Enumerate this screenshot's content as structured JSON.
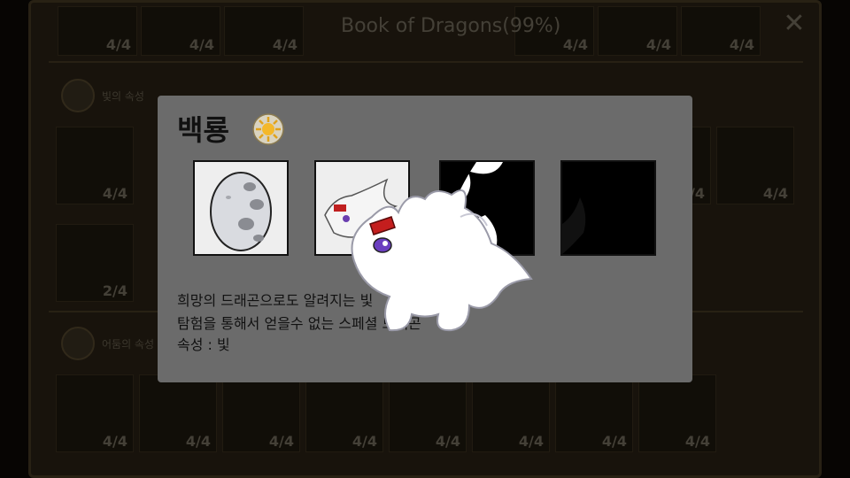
{
  "book": {
    "title": "Book of Dragons(99%)",
    "close_label": "✕",
    "top_counts": [
      "4/4",
      "4/4",
      "4/4",
      "4/4",
      "4/4",
      "4/4"
    ],
    "section_light_label": "빛의 속성",
    "section_dark_label": "어둠의 속성",
    "light_counts": [
      "4/4",
      "4/4",
      "4/4",
      "2/4"
    ],
    "dark_counts": [
      "4/4",
      "4/4",
      "4/4",
      "4/4",
      "4/4",
      "4/4",
      "4/4",
      "4/4"
    ]
  },
  "modal": {
    "title": "백룡",
    "element_icon": "sun-icon",
    "stages": [
      "egg",
      "baby",
      "locked-silhouette",
      "locked-silhouette"
    ],
    "description": [
      "희망의 드래곤으로도 알려지는 빛",
      "탐험을 통해서 얻을수 없는 스페셜 드래곤",
      "속성 : 빛"
    ]
  },
  "colors": {
    "modal_bg": "#6b6b6b",
    "frame_bg": "#2c2417",
    "title_color": "#7d7565"
  }
}
